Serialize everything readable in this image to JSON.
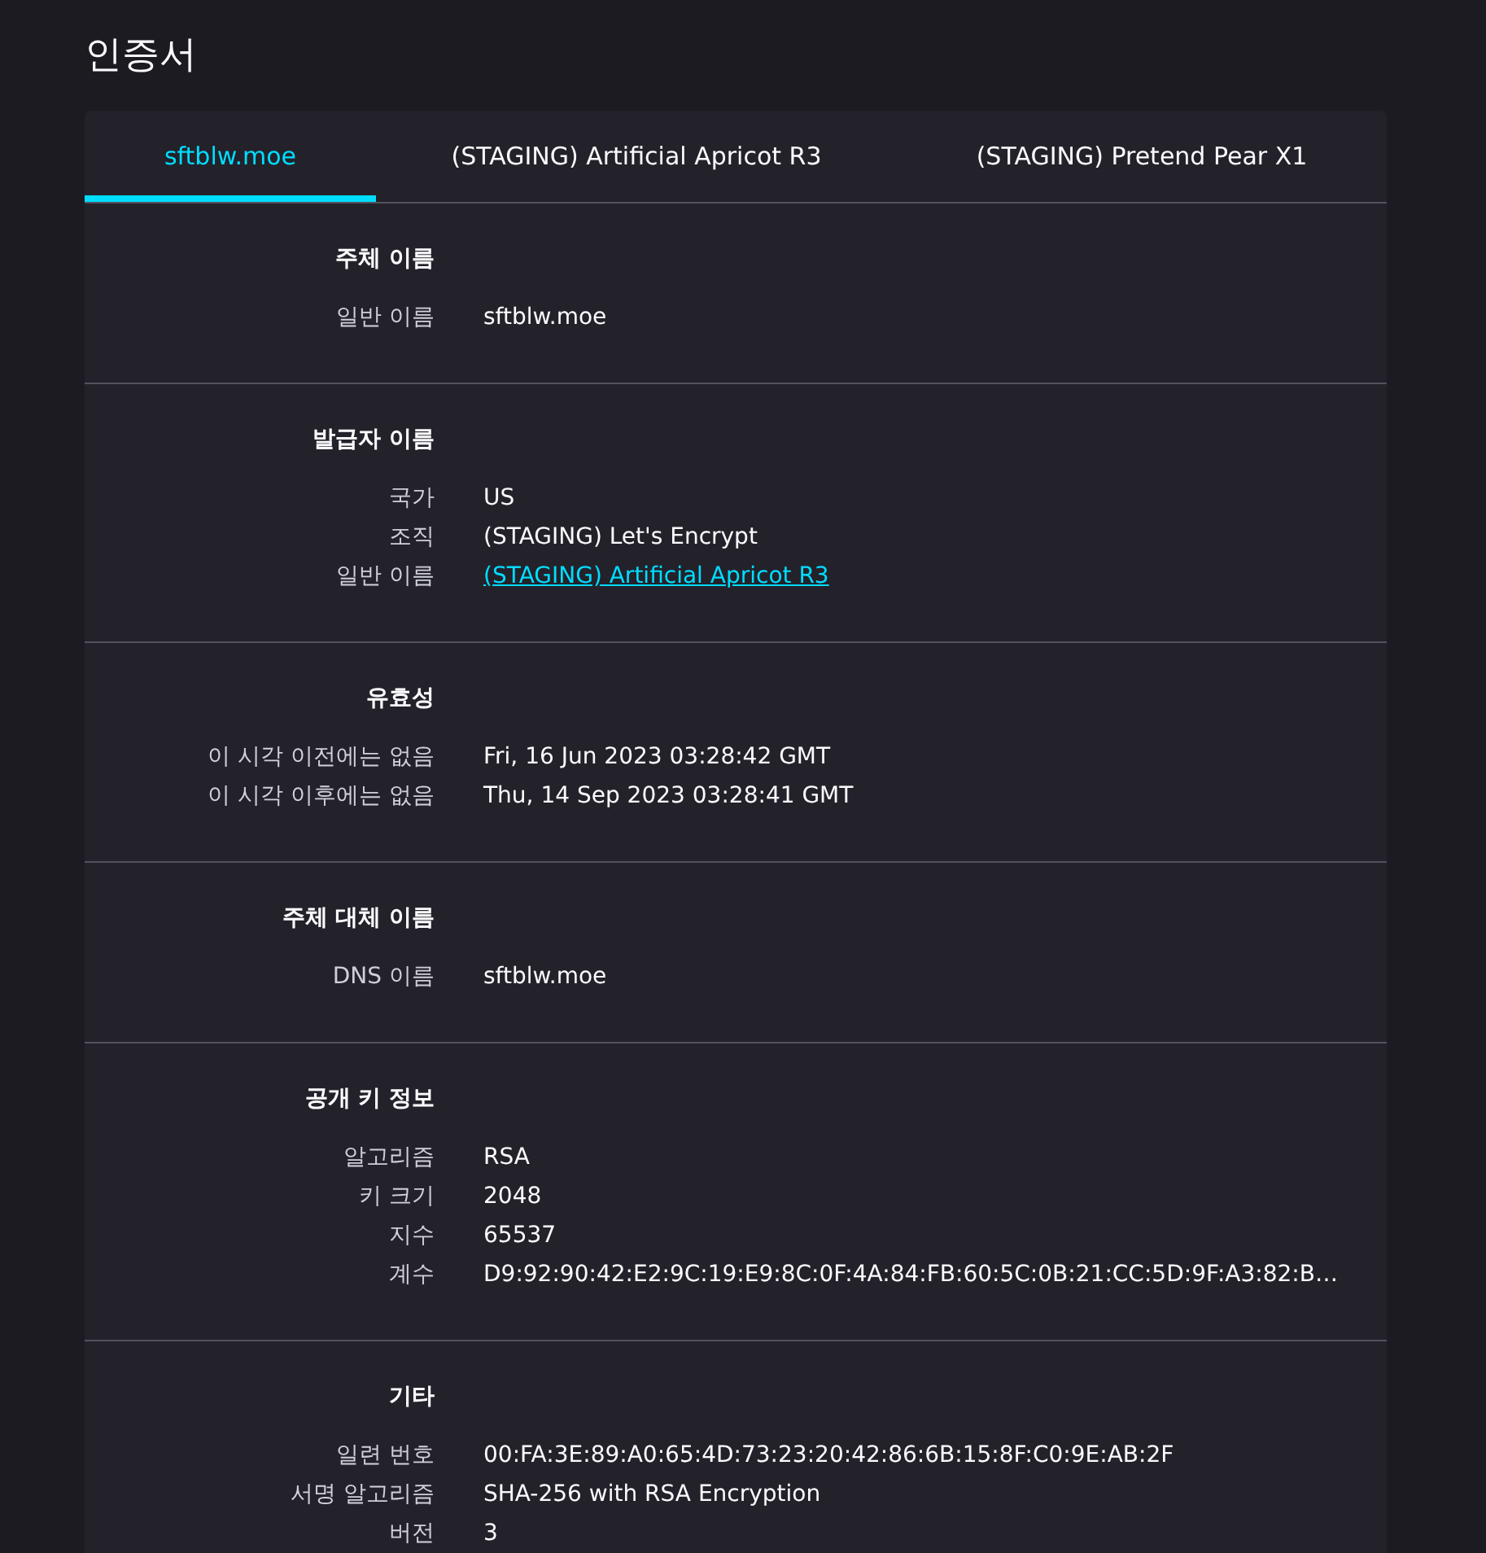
{
  "title": "인증서",
  "tabs": [
    {
      "label": "sftblw.moe",
      "selected": true
    },
    {
      "label": "(STAGING) Artificial Apricot R3",
      "selected": false
    },
    {
      "label": "(STAGING) Pretend Pear X1",
      "selected": false
    }
  ],
  "sections": [
    {
      "heading": "주체 이름",
      "rows": [
        {
          "label": "일반 이름",
          "value": "sftblw.moe",
          "kind": "text"
        }
      ]
    },
    {
      "heading": "발급자 이름",
      "rows": [
        {
          "label": "국가",
          "value": "US",
          "kind": "text"
        },
        {
          "label": "조직",
          "value": "(STAGING) Let's Encrypt",
          "kind": "text"
        },
        {
          "label": "일반 이름",
          "value": "(STAGING) Artificial Apricot R3",
          "kind": "link"
        }
      ]
    },
    {
      "heading": "유효성",
      "rows": [
        {
          "label": "이 시각 이전에는 없음",
          "value": "Fri, 16 Jun 2023 03:28:42 GMT",
          "kind": "text"
        },
        {
          "label": "이 시각 이후에는 없음",
          "value": "Thu, 14 Sep 2023 03:28:41 GMT",
          "kind": "text"
        }
      ]
    },
    {
      "heading": "주체 대체 이름",
      "rows": [
        {
          "label": "DNS 이름",
          "value": "sftblw.moe",
          "kind": "text"
        }
      ]
    },
    {
      "heading": "공개 키 정보",
      "rows": [
        {
          "label": "알고리즘",
          "value": "RSA",
          "kind": "text"
        },
        {
          "label": "키 크기",
          "value": "2048",
          "kind": "text"
        },
        {
          "label": "지수",
          "value": "65537",
          "kind": "text"
        },
        {
          "label": "계수",
          "value": "D9:92:90:42:E2:9C:19:E9:8C:0F:4A:84:FB:60:5C:0B:21:CC:5D:9F:A3:82:B…",
          "kind": "text"
        }
      ]
    },
    {
      "heading": "기타",
      "rows": [
        {
          "label": "일련 번호",
          "value": "00:FA:3E:89:A0:65:4D:73:23:20:42:86:6B:15:8F:C0:9E:AB:2F",
          "kind": "text"
        },
        {
          "label": "서명 알고리즘",
          "value": "SHA-256 with RSA Encryption",
          "kind": "text"
        },
        {
          "label": "버전",
          "value": "3",
          "kind": "text"
        }
      ]
    }
  ]
}
